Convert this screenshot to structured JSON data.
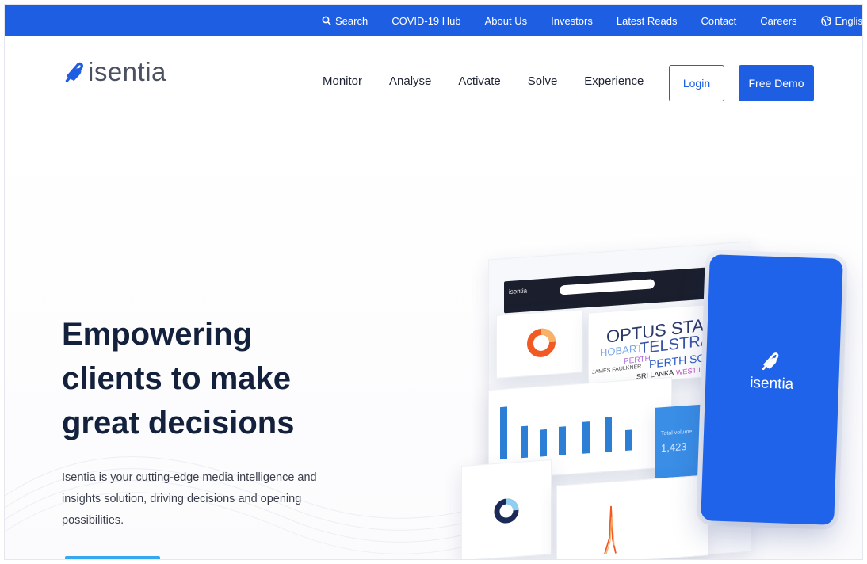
{
  "topbar": {
    "search_label": "Search",
    "covid_label": "COVID-19 Hub",
    "about_label": "About Us",
    "investors_label": "Investors",
    "latest_label": "Latest Reads",
    "contact_label": "Contact",
    "careers_label": "Careers",
    "language_label": "English"
  },
  "brand": {
    "name": "isentia"
  },
  "nav": {
    "items": [
      "Monitor",
      "Analyse",
      "Activate",
      "Solve",
      "Experience"
    ],
    "login_label": "Login",
    "demo_label": "Free Demo"
  },
  "hero": {
    "headline_line1": "Empowering",
    "headline_line2": "clients to make",
    "headline_line3": "great decisions",
    "description": "Isentia is your cutting-edge media intelligence and insights solution, driving decisions and opening possibilities."
  },
  "mockup": {
    "word_cloud": [
      "OPTUS STADIUM",
      "HOBART",
      "TELSTRA",
      "PERTH",
      "PERTH SCORCHERS",
      "JAMES FAULKNER",
      "SRI LANKA",
      "WEST INDIES"
    ],
    "phone_brand": "isentia",
    "total_value": "1,423",
    "total_label": "Total volume"
  },
  "colors": {
    "primary": "#1d5ee3",
    "dark": "#14213d",
    "donut_orange": "#f25a23"
  }
}
